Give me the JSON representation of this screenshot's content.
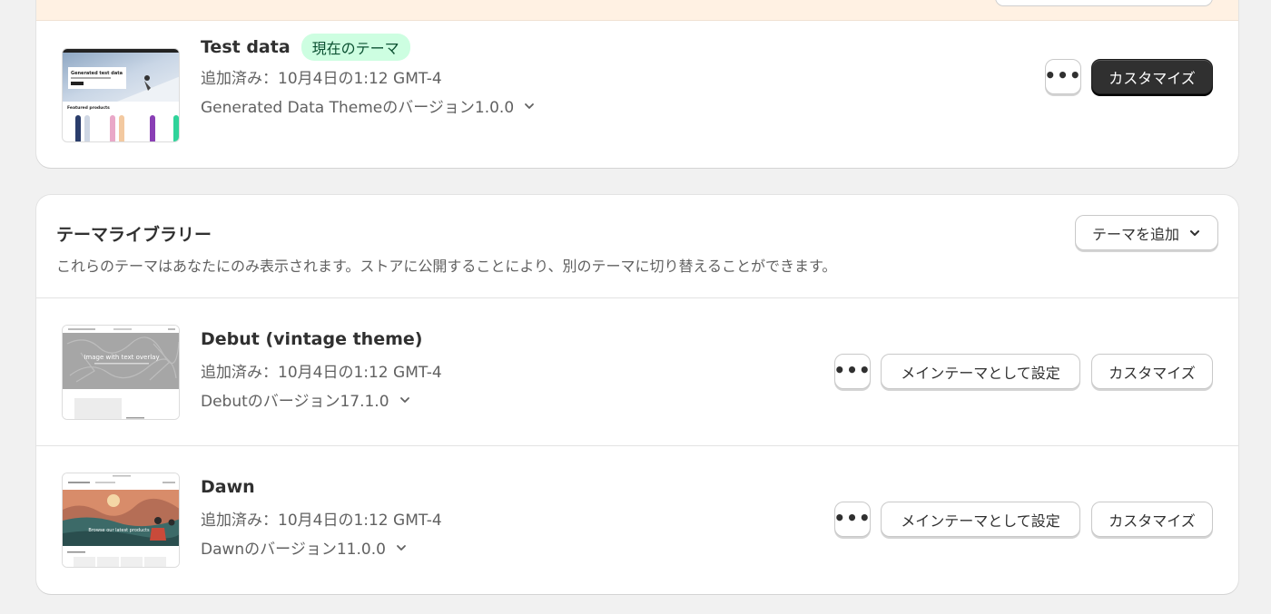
{
  "current_theme": {
    "name": "Test data",
    "badge": "現在のテーマ",
    "added": "追加済み：10月4日の1:12 GMT-4",
    "version": "Generated Data Themeのバージョン1.0.0",
    "more_label": "•••",
    "customize_label": "カスタマイズ",
    "thumb": {
      "hero_title": "Generated test data",
      "section_title": "Featured products"
    }
  },
  "library": {
    "title": "テーマライブラリー",
    "description": "これらのテーマはあなたにのみ表示されます。ストアに公開することにより、別のテーマに切り替えることができます。",
    "add_theme_label": "テーマを追加",
    "themes": [
      {
        "name": "Debut (vintage theme)",
        "added": "追加済み：10月4日の1:12 GMT-4",
        "version": "Debutのバージョン17.1.0",
        "more_label": "•••",
        "publish_label": "メインテーマとして設定",
        "customize_label": "カスタマイズ",
        "thumb_text": "Image with text overlay"
      },
      {
        "name": "Dawn",
        "added": "追加済み：10月4日の1:12 GMT-4",
        "version": "Dawnのバージョン11.0.0",
        "more_label": "•••",
        "publish_label": "メインテーマとして設定",
        "customize_label": "カスタマイズ",
        "thumb_text": "Browse our latest products"
      }
    ]
  },
  "colors": {
    "badge_bg": "#cdfee1",
    "badge_text": "#0c5132",
    "primary_button": "#303030",
    "banner": "#fff1e3",
    "page_bg": "#f1f1f1"
  }
}
